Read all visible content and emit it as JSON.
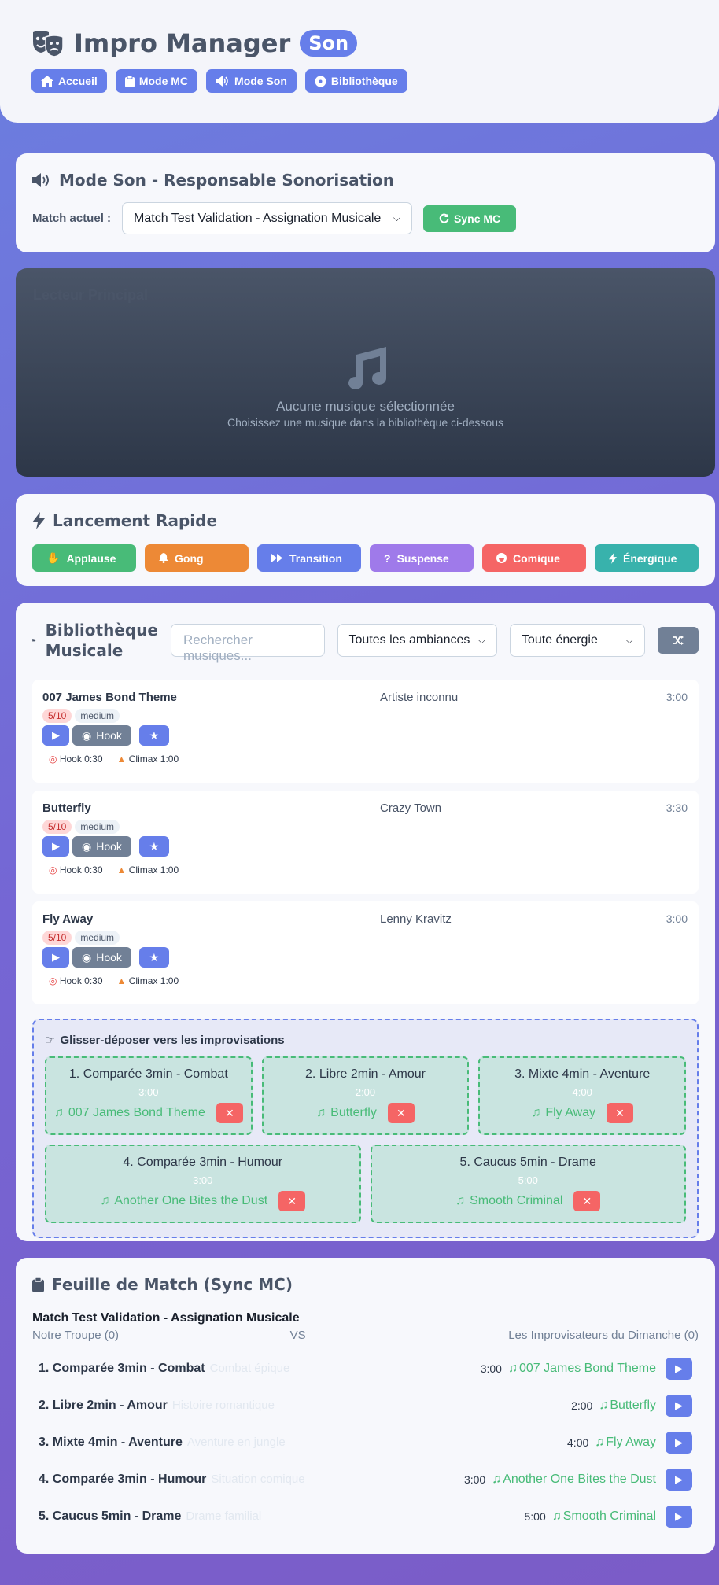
{
  "header": {
    "title": "Impro Manager",
    "badge": "Son",
    "nav": [
      {
        "label": "Accueil",
        "icon": "home-icon"
      },
      {
        "label": "Mode MC",
        "icon": "clipboard-icon"
      },
      {
        "label": "Mode Son",
        "icon": "speaker-icon"
      },
      {
        "label": "Bibliothèque",
        "icon": "disc-icon"
      }
    ]
  },
  "mode_son": {
    "title": "Mode Son - Responsable Sonorisation",
    "match_label": "Match actuel :",
    "match_value": "Match Test Validation - Assignation Musicale",
    "sync_label": "Sync MC"
  },
  "player": {
    "ghost_title": "Lecteur Principal",
    "empty_title": "Aucune musique sélectionnée",
    "empty_sub": "Choisissez une musique dans la bibliothèque ci-dessous"
  },
  "quick": {
    "title": "Lancement Rapide",
    "buttons": [
      {
        "label": "Applause",
        "color": "#48bb78",
        "icon": "clap-icon"
      },
      {
        "label": "Gong",
        "color": "#ed8936",
        "icon": "bell-icon"
      },
      {
        "label": "Transition",
        "color": "#667eea",
        "icon": "fast-forward-icon"
      },
      {
        "label": "Suspense",
        "color": "#9f7aea",
        "icon": "question-icon"
      },
      {
        "label": "Comique",
        "color": "#f56565",
        "icon": "laugh-icon"
      },
      {
        "label": "Énergique",
        "color": "#38b2ac",
        "icon": "bolt-icon"
      }
    ]
  },
  "library": {
    "title": "Bibliothèque Musicale",
    "search_placeholder": "Rechercher musiques...",
    "ambiance": "Toutes les ambiances",
    "energy": "Toute énergie",
    "tracks": [
      {
        "title": "007 James Bond Theme",
        "artist": "Artiste inconnu",
        "duration": "3:00",
        "score": "5/10",
        "level": "medium",
        "hook_btn": "Hook",
        "hook": "Hook 0:30",
        "climax": "Climax 1:00"
      },
      {
        "title": "Butterfly",
        "artist": "Crazy Town",
        "duration": "3:30",
        "score": "5/10",
        "level": "medium",
        "hook_btn": "Hook",
        "hook": "Hook 0:30",
        "climax": "Climax 1:00"
      },
      {
        "title": "Fly Away",
        "artist": "Lenny Kravitz",
        "duration": "3:00",
        "score": "5/10",
        "level": "medium",
        "hook_btn": "Hook",
        "hook": "Hook 0:30",
        "climax": "Climax 1:00"
      }
    ],
    "dropzone_title": "Glisser-déposer vers les improvisations",
    "slots": [
      {
        "name": "1. Comparée 3min - Combat",
        "time": "3:00",
        "music": "007 James Bond Theme"
      },
      {
        "name": "2. Libre 2min - Amour",
        "time": "2:00",
        "music": "Butterfly"
      },
      {
        "name": "3. Mixte 4min - Aventure",
        "time": "4:00",
        "music": "Fly Away"
      },
      {
        "name": "4. Comparée 3min - Humour",
        "time": "3:00",
        "music": "Another One Bites the Dust"
      },
      {
        "name": "5. Caucus 5min - Drame",
        "time": "5:00",
        "music": "Smooth Criminal"
      }
    ]
  },
  "feuille": {
    "title": "Feuille de Match (Sync MC)",
    "match": "Match Test Validation - Assignation Musicale",
    "team_a": "Notre Troupe (0)",
    "vs": "VS",
    "team_b": "Les Improvisateurs du Dimanche (0)",
    "rows": [
      {
        "name": "1. Comparée 3min - Combat",
        "ghost": "Combat épique",
        "time": "3:00",
        "music": "007 James Bond Theme"
      },
      {
        "name": "2. Libre 2min - Amour",
        "ghost": "Histoire romantique",
        "time": "2:00",
        "music": "Butterfly"
      },
      {
        "name": "3. Mixte 4min - Aventure",
        "ghost": "Aventure en jungle",
        "time": "4:00",
        "music": "Fly Away"
      },
      {
        "name": "4. Comparée 3min - Humour",
        "ghost": "Situation comique",
        "time": "3:00",
        "music": "Another One Bites the Dust"
      },
      {
        "name": "5. Caucus 5min - Drame",
        "ghost": "Drame familial",
        "time": "5:00",
        "music": "Smooth Criminal"
      }
    ]
  }
}
